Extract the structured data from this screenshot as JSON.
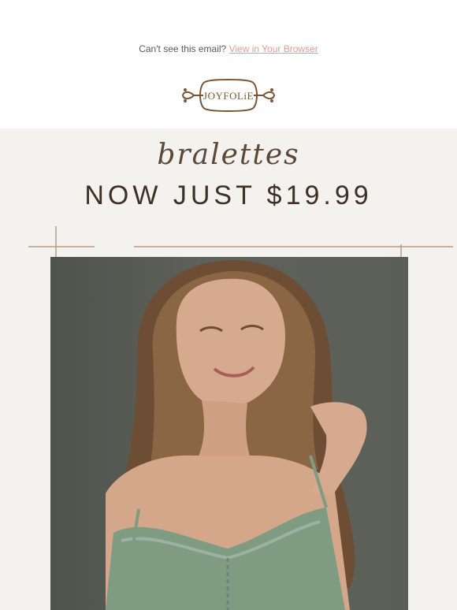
{
  "header": {
    "preheader_text": "Can't see this email?",
    "view_link_label": "View in Your Browser",
    "logo_text": "JOYFOLiE"
  },
  "promo": {
    "script_title": "bralettes",
    "headline": "NOW JUST $19.99"
  },
  "colors": {
    "link": "#e79a8f",
    "promo_bg": "#f3f2ee",
    "accent_brown": "#7a5535",
    "photo_bg": "#585c55",
    "top_green": "#7f9b82"
  },
  "photo": {
    "alt_icon": "model-photo"
  }
}
